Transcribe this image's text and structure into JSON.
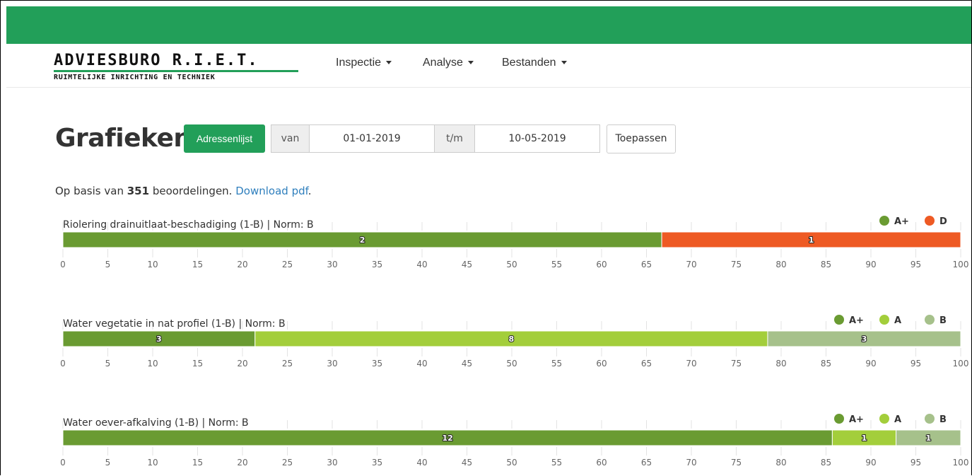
{
  "logo": {
    "title": "ADVIESBURO R.I.E.T.",
    "subtitle": "RUIMTELIJKE INRICHTING EN TECHNIEK"
  },
  "nav": [
    {
      "label": "Inspectie"
    },
    {
      "label": "Analyse"
    },
    {
      "label": "Bestanden"
    }
  ],
  "page": {
    "title": "Grafieken",
    "address_button": "Adressenlijst",
    "from_label": "van",
    "from_value": "01-01-2019",
    "to_label": "t/m",
    "to_value": "10-05-2019",
    "apply_button": "Toepassen"
  },
  "summary": {
    "prefix": "Op basis van",
    "count": "351",
    "suffix": "beoordelingen.",
    "link": "Download pdf",
    "link_suffix": "."
  },
  "colors": {
    "topbar": "#229f59",
    "A+": "#6a9b32",
    "A": "#a3ce3b",
    "B": "#a6c18b",
    "D": "#ee5a24",
    "link": "#2f7fbd"
  },
  "chart_data": [
    {
      "type": "bar",
      "orientation": "horizontal-stacked-percent",
      "title": "Riolering drainuitlaat-beschadiging (1-B) | Norm: B",
      "xlim": [
        0,
        100
      ],
      "xticks": [
        0,
        5,
        10,
        15,
        20,
        25,
        30,
        35,
        40,
        45,
        50,
        55,
        60,
        65,
        70,
        75,
        80,
        85,
        90,
        95,
        100
      ],
      "legend_position": "top-right",
      "series": [
        {
          "name": "A+",
          "count": 2,
          "percent": 66.7
        },
        {
          "name": "D",
          "count": 1,
          "percent": 33.3
        }
      ]
    },
    {
      "type": "bar",
      "orientation": "horizontal-stacked-percent",
      "title": "Water vegetatie in nat profiel (1-B) | Norm: B",
      "xlim": [
        0,
        100
      ],
      "xticks": [
        0,
        5,
        10,
        15,
        20,
        25,
        30,
        35,
        40,
        45,
        50,
        55,
        60,
        65,
        70,
        75,
        80,
        85,
        90,
        95,
        100
      ],
      "legend_position": "top-right",
      "series": [
        {
          "name": "A+",
          "count": 3,
          "percent": 21.4
        },
        {
          "name": "A",
          "count": 8,
          "percent": 57.1
        },
        {
          "name": "B",
          "count": 3,
          "percent": 21.5
        }
      ]
    },
    {
      "type": "bar",
      "orientation": "horizontal-stacked-percent",
      "title": "Water oever-afkalving (1-B) | Norm: B",
      "xlim": [
        0,
        100
      ],
      "xticks": [
        0,
        5,
        10,
        15,
        20,
        25,
        30,
        35,
        40,
        45,
        50,
        55,
        60,
        65,
        70,
        75,
        80,
        85,
        90,
        95,
        100
      ],
      "legend_position": "top-right",
      "series": [
        {
          "name": "A+",
          "count": 12,
          "percent": 85.7
        },
        {
          "name": "A",
          "count": 1,
          "percent": 7.1
        },
        {
          "name": "B",
          "count": 1,
          "percent": 7.2
        }
      ]
    }
  ]
}
